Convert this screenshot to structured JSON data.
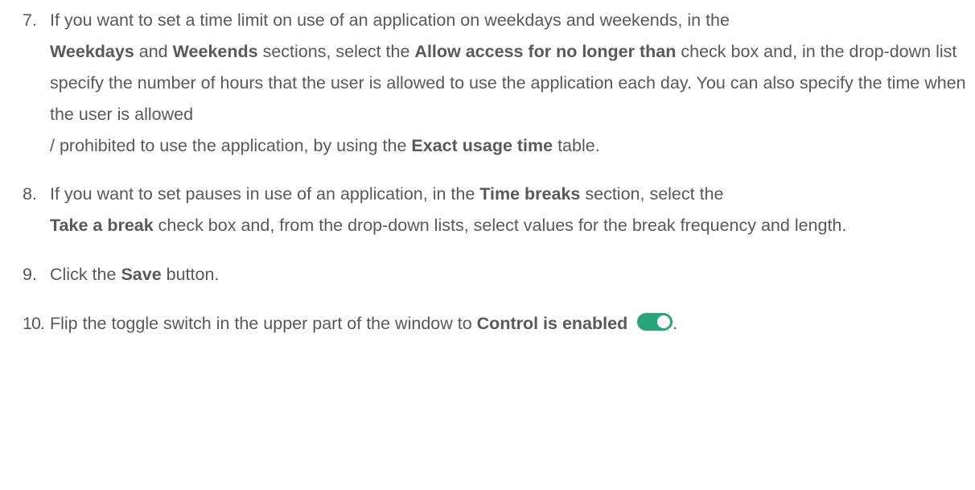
{
  "steps": [
    {
      "number": "7.",
      "parts": [
        "If you want to set a time limit on use of an application on weekdays and weekends, in the",
        "Weekdays",
        "and",
        "Weekends",
        "sections, select the",
        "Allow access for no longer than",
        "check box and, in the drop-down list specify the number of hours that the user is allowed to use the application each day. You can also specify the time when the user is allowed",
        "/ prohibited to use the application, by using the",
        "Exact usage time",
        "table."
      ]
    },
    {
      "number": "8.",
      "parts": [
        "If you want to set pauses in use of an application, in the",
        "Time breaks",
        "section, select the",
        "Take a break",
        "check box and, from the drop-down lists, select values for the break frequency and length."
      ]
    },
    {
      "number": "9.",
      "parts": [
        "Click the",
        "Save",
        "button."
      ]
    },
    {
      "number": "10.",
      "parts": [
        "Flip the toggle switch in the upper part of the window to",
        "Control is enabled",
        "."
      ]
    }
  ],
  "toggle": {
    "state": "on",
    "color": "#2aa578"
  }
}
